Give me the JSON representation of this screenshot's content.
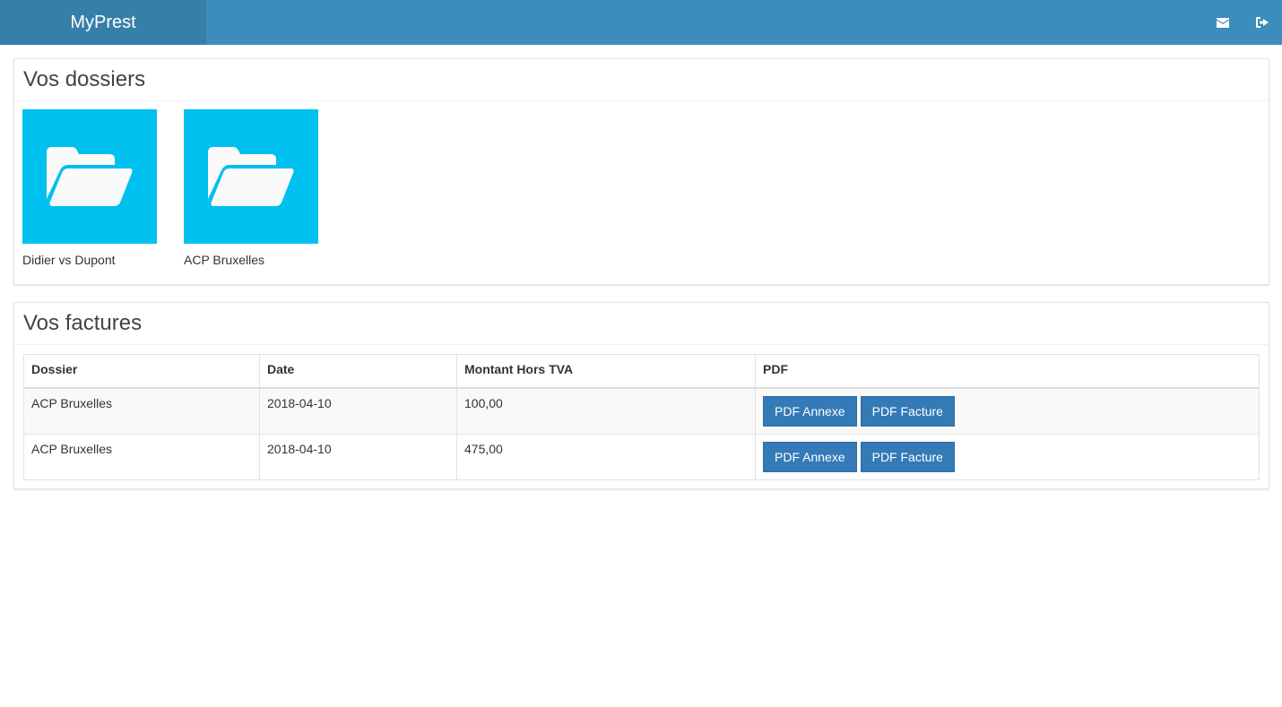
{
  "app": {
    "brand": "MyPrest"
  },
  "header": {
    "icons": [
      "envelope-icon",
      "sign-out-icon"
    ]
  },
  "dossiers": {
    "title": "Vos dossiers",
    "items": [
      {
        "label": "Didier vs Dupont",
        "icon": "folder-open-icon"
      },
      {
        "label": "ACP Bruxelles",
        "icon": "folder-open-icon"
      }
    ]
  },
  "factures": {
    "title": "Vos factures",
    "columns": [
      "Dossier",
      "Date",
      "Montant Hors TVA",
      "PDF"
    ],
    "rows": [
      {
        "dossier": "ACP Bruxelles",
        "date": "2018-04-10",
        "montant": "100,00",
        "btn_annexe": "PDF Annexe",
        "btn_facture": "PDF Facture"
      },
      {
        "dossier": "ACP Bruxelles",
        "date": "2018-04-10",
        "montant": "475,00",
        "btn_annexe": "PDF Annexe",
        "btn_facture": "PDF Facture"
      }
    ]
  },
  "colors": {
    "header": "#3c8dbc",
    "brand_bg": "#367fa9",
    "tile": "#00c0ef",
    "button": "#337ab7"
  }
}
